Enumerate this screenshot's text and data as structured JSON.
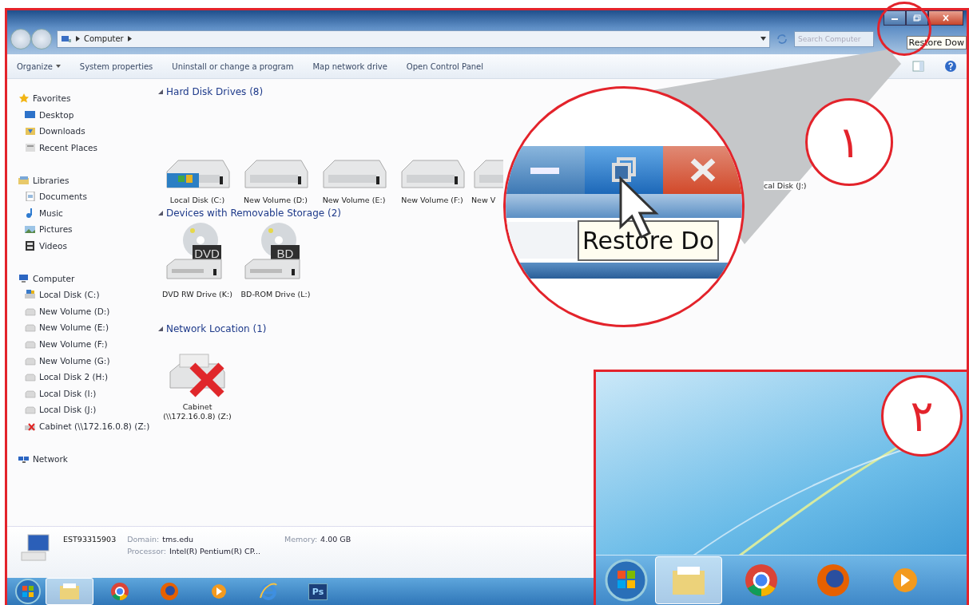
{
  "window": {
    "address": [
      "Computer"
    ],
    "search": {
      "placeholder": "Search Computer"
    },
    "tooltip": "Restore Dow"
  },
  "toolbar": [
    {
      "label": "Organize",
      "dropdown": true
    },
    {
      "label": "System properties",
      "dropdown": false
    },
    {
      "label": "Uninstall or change a program",
      "dropdown": false
    },
    {
      "label": "Map network drive",
      "dropdown": false
    },
    {
      "label": "Open Control Panel",
      "dropdown": false
    }
  ],
  "sidebar": [
    {
      "label": "Favorites",
      "kind": "star",
      "children": [
        {
          "label": "Desktop",
          "kind": "desktop"
        },
        {
          "label": "Downloads",
          "kind": "folder"
        },
        {
          "label": "Recent Places",
          "kind": "recent"
        }
      ]
    },
    {
      "label": "Libraries",
      "kind": "library",
      "children": [
        {
          "label": "Documents",
          "kind": "document"
        },
        {
          "label": "Music",
          "kind": "music"
        },
        {
          "label": "Pictures",
          "kind": "picture"
        },
        {
          "label": "Videos",
          "kind": "video"
        }
      ]
    },
    {
      "label": "Computer",
      "kind": "computer",
      "children": [
        {
          "label": "Local Disk (C:)",
          "kind": "system-disk"
        },
        {
          "label": "New Volume (D:)",
          "kind": "disk"
        },
        {
          "label": "New Volume (E:)",
          "kind": "disk"
        },
        {
          "label": "New Volume (F:)",
          "kind": "disk"
        },
        {
          "label": "New Volume (G:)",
          "kind": "disk"
        },
        {
          "label": "Local Disk 2 (H:)",
          "kind": "disk"
        },
        {
          "label": "Local Disk (I:)",
          "kind": "disk"
        },
        {
          "label": "Local Disk (J:)",
          "kind": "disk"
        },
        {
          "label": "Cabinet (\\\\172.16.0.8) (Z:)",
          "kind": "network-error"
        }
      ]
    },
    {
      "label": "Network",
      "kind": "network"
    }
  ],
  "sections": [
    {
      "title": "Hard Disk Drives (8)",
      "items": [
        {
          "label": "Local Disk (C:)",
          "kind": "system-disk"
        },
        {
          "label": "New Volume (D:)",
          "kind": "disk"
        },
        {
          "label": "New Volume (E:)",
          "kind": "disk"
        },
        {
          "label": "New Volume (F:)",
          "kind": "disk"
        },
        {
          "label": "New V",
          "kind": "disk"
        }
      ]
    },
    {
      "title": "Devices with Removable Storage (2)",
      "items": [
        {
          "label": "DVD RW Drive (K:)",
          "kind": "optical",
          "badge": "DVD"
        },
        {
          "label": "BD-ROM Drive (L:)",
          "kind": "optical",
          "badge": "BD"
        }
      ]
    },
    {
      "title": "Network Location (1)",
      "items": [
        {
          "label": "Cabinet (\\\\172.16.0.8) (Z:)",
          "kind": "network-error"
        }
      ]
    }
  ],
  "hidden_drive": {
    "label": "cal Disk (J:)"
  },
  "details": {
    "name": "EST93315903",
    "fields": [
      {
        "label": "Domain:",
        "value": "tms.edu"
      },
      {
        "label": "Memory:",
        "value": "4.00 GB"
      },
      {
        "label": "Processor:",
        "value": "Intel(R) Pentium(R) CP..."
      }
    ]
  },
  "taskbar": [
    {
      "kind": "explorer",
      "selected": true
    },
    {
      "kind": "chrome",
      "selected": false
    },
    {
      "kind": "firefox",
      "selected": false
    },
    {
      "kind": "media",
      "selected": false
    },
    {
      "kind": "ie",
      "selected": false
    },
    {
      "kind": "photoshop",
      "selected": false,
      "text": "Ps"
    }
  ],
  "callouts": [
    {
      "number": "١",
      "caption": "Restore Do"
    },
    {
      "number": "٢",
      "taskbar": [
        {
          "kind": "explorer",
          "selected": true
        },
        {
          "kind": "chrome",
          "selected": false
        },
        {
          "kind": "firefox",
          "selected": false
        },
        {
          "kind": "media",
          "selected": false
        }
      ]
    }
  ]
}
